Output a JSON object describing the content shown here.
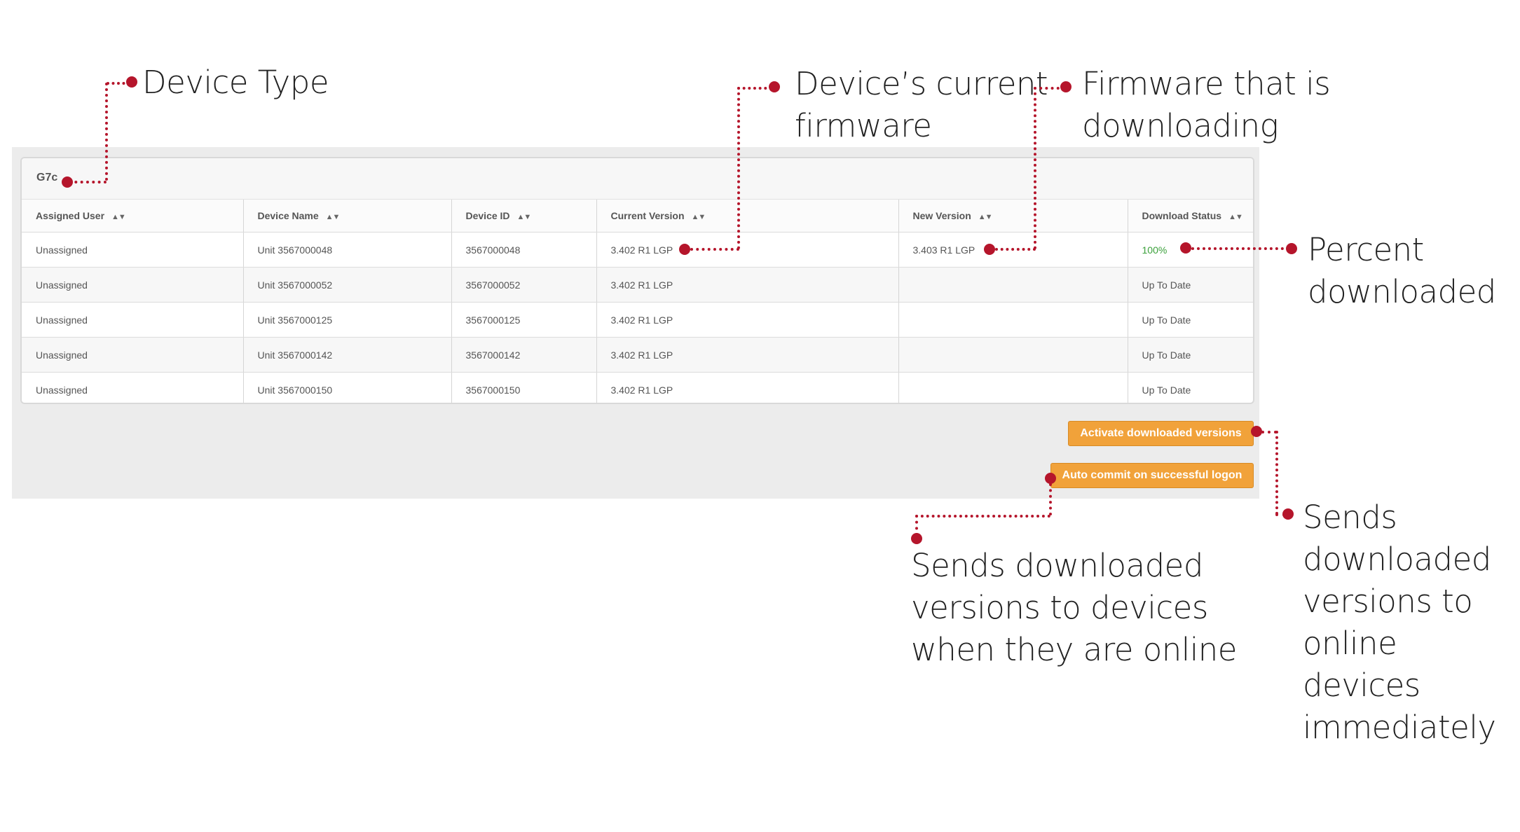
{
  "device_group": {
    "title": "G7c"
  },
  "table": {
    "columns": [
      "Assigned User",
      "Device Name",
      "Device ID",
      "Current Version",
      "New Version",
      "Download Status"
    ],
    "sort_icon": "sort-updown-icon",
    "rows": [
      {
        "user": "Unassigned",
        "name": "Unit 3567000048",
        "id": "3567000048",
        "current": "3.402 R1 LGP",
        "new": "3.403 R1 LGP",
        "status": "100%"
      },
      {
        "user": "Unassigned",
        "name": "Unit 3567000052",
        "id": "3567000052",
        "current": "3.402 R1 LGP",
        "new": "",
        "status": "Up To Date"
      },
      {
        "user": "Unassigned",
        "name": "Unit 3567000125",
        "id": "3567000125",
        "current": "3.402 R1 LGP",
        "new": "",
        "status": "Up To Date"
      },
      {
        "user": "Unassigned",
        "name": "Unit 3567000142",
        "id": "3567000142",
        "current": "3.402 R1 LGP",
        "new": "",
        "status": "Up To Date"
      },
      {
        "user": "Unassigned",
        "name": "Unit 3567000150",
        "id": "3567000150",
        "current": "3.402 R1 LGP",
        "new": "",
        "status": "Up To Date"
      }
    ]
  },
  "buttons": {
    "activate": "Activate downloaded versions",
    "auto_commit": "Auto commit on successful logon"
  },
  "annotations": {
    "device_type": "Device Type",
    "current_firmware": [
      "Device’s current",
      "firmware"
    ],
    "downloading_firmware": [
      "Firmware that is",
      "downloading"
    ],
    "percent": [
      "Percent",
      "downloaded"
    ],
    "auto_commit": [
      "Sends downloaded",
      "versions to devices",
      "when they are online"
    ],
    "activate": [
      "Sends",
      "downloaded",
      "versions to",
      "online devices",
      "immediately"
    ]
  },
  "colors": {
    "accent_button": "#f1a23a",
    "annotation_marker": "#b5152b",
    "percent_text": "#3aa03a"
  }
}
